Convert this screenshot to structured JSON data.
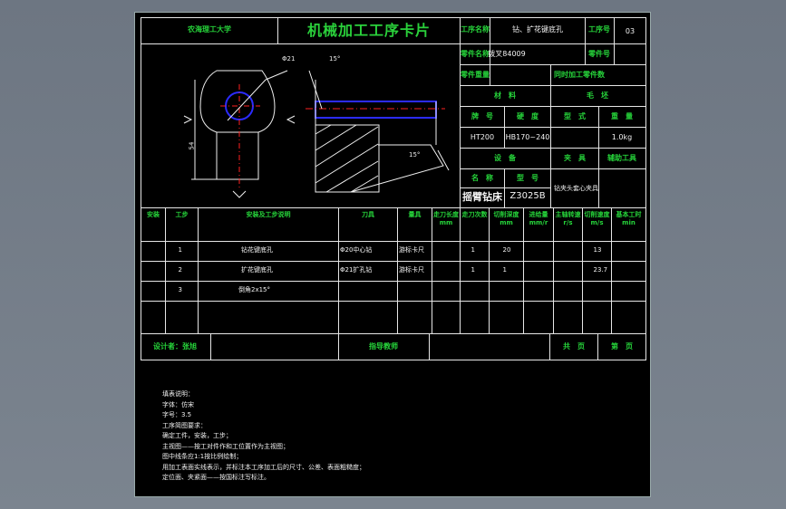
{
  "header": {
    "school": "农海理工大学",
    "title": "机械加工工序卡片",
    "process_name_label": "工序名称",
    "process_name_value": "钻、扩花键底孔",
    "process_no_label": "工序号",
    "process_no_value": "03",
    "part_name_label": "零件名称",
    "part_name_value": "拨叉84009",
    "part_no_label": "零件号",
    "part_weight_label": "零件重量",
    "same_time_label": "同时加工零件数"
  },
  "drawing": {
    "dia_label": "Φ21",
    "angle_top": "15°",
    "angle_bottom": "15°",
    "dim_height": "54"
  },
  "material": {
    "material_label": "材　料",
    "blank_label": "毛　坯",
    "grade_label": "牌　号",
    "hardness_label": "硬　度",
    "type_label": "型　式",
    "weight_label": "重　量",
    "grade": "HT200",
    "hardness": "HB170~240",
    "weight": "1.0kg"
  },
  "equipment": {
    "equipment_label": "设　备",
    "fixture_label": "夹　具",
    "aux_tool_label": "辅助工具",
    "name_label": "名　称",
    "model_label": "型　号",
    "machine_name": "摇臂钻床",
    "machine_model": "Z3025B",
    "fixture": "钻夹头套心夹具"
  },
  "step_table": {
    "headers": [
      "安装",
      "工步",
      "安装及工步说明",
      "刀具",
      "量具",
      "走刀长度mm",
      "走刀次数",
      "切削深度mm",
      "进给量mm/r",
      "主轴转速r/s",
      "切削速度m/s",
      "基本工时min"
    ],
    "rows": [
      {
        "step": "1",
        "desc": "钻花键底孔",
        "tool": "Φ20中心钻",
        "gauge": "游标卡尺",
        "passes": "1",
        "depth": "20",
        "speed_mps": "13"
      },
      {
        "step": "2",
        "desc": "扩花键底孔",
        "tool": "Φ21扩孔钻",
        "gauge": "游标卡尺",
        "passes": "1",
        "depth": "1",
        "speed_mps": "23.7"
      },
      {
        "step": "3",
        "desc": "倒角2x15°",
        "tool": "",
        "gauge": "",
        "passes": "",
        "depth": "",
        "speed_mps": ""
      }
    ]
  },
  "footer": {
    "designer_label": "设计者：张旭",
    "advisor_label": "指导教师",
    "total_pages_label": "共　页",
    "page_label": "第　页"
  },
  "notes": [
    "填表说明：",
    "字体：仿宋",
    "字号：3.5",
    "工序简图要求：",
    "确定工件，安装，工步；",
    "主视图——按工对件作和工位置作为主视图；",
    "图中线条应1:1按比例绘制；",
    "用加工表面实线表示，并标注本工序加工后的尺寸、公差、表面粗糙度；",
    "定位面、夹紧面——按国标注写标注。"
  ],
  "colors": {
    "green": "#26d43a",
    "blue": "#2b2bff",
    "red": "#ff2020",
    "white": "#e8e8e8"
  }
}
